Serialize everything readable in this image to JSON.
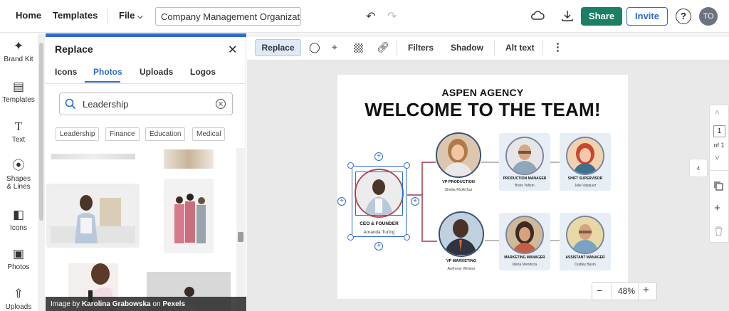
{
  "topbar": {
    "home": "Home",
    "templates": "Templates",
    "file": "File",
    "doc_title": "Company Management Organizati...",
    "share": "Share",
    "invite": "Invite",
    "help": "?",
    "avatar": "TO"
  },
  "rail": {
    "items": [
      {
        "label": "Brand Kit",
        "icon": "magic-wand-icon"
      },
      {
        "label": "Templates",
        "icon": "templates-icon"
      },
      {
        "label": "Text",
        "icon": "text-icon"
      },
      {
        "label": "Shapes & Lines",
        "icon": "shapes-icon"
      },
      {
        "label": "Icons",
        "icon": "icons-icon"
      },
      {
        "label": "Photos",
        "icon": "photo-icon"
      },
      {
        "label": "Uploads",
        "icon": "upload-icon"
      }
    ]
  },
  "panel": {
    "title": "Replace",
    "tabs": [
      "Icons",
      "Photos",
      "Uploads",
      "Logos"
    ],
    "active_tab": "Photos",
    "search_value": "Leadership",
    "chips": [
      "Leadership",
      "Finance",
      "Education",
      "Medical"
    ],
    "credit_prefix": "Image by ",
    "credit_author": "Karolina Grabowska",
    "credit_mid": " on ",
    "credit_source": "Pexels"
  },
  "toolbar": {
    "replace": "Replace",
    "filters": "Filters",
    "shadow": "Shadow",
    "alt_text": "Alt text"
  },
  "chart": {
    "company": "ASPEN AGENCY",
    "heading": "WELCOME TO THE TEAM!",
    "ceo": {
      "role": "CEO & FOUNDER",
      "name": "Amanda Turing"
    },
    "vp_production": {
      "role": "VP PRODUCTION",
      "name": "Sheila McArthur"
    },
    "vp_marketing": {
      "role": "VP MARKETING",
      "name": "Anthony Writers"
    },
    "production_manager": {
      "role": "PRODUCTION MANAGER",
      "name": "Boris Yeltsin"
    },
    "shift_supervisor": {
      "role": "SHIFT SUPERVISOR",
      "name": "Julie Vasquez"
    },
    "marketing_manager": {
      "role": "MARKETING MANAGER",
      "name": "Maria Mendoza"
    },
    "assistant_manager": {
      "role": "ASSISTANT MANAGER",
      "name": "Dudley Basin"
    }
  },
  "right_panel": {
    "page_number": "1",
    "page_of": "of 1"
  },
  "zoom": {
    "minus": "−",
    "value": "48%",
    "plus": "+"
  },
  "colors": {
    "accent": "#2d6bcf",
    "share": "#1a7f64",
    "connector": "#a33a48",
    "card": "#e7eef6"
  }
}
